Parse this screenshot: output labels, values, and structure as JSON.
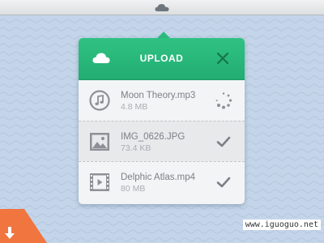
{
  "colors": {
    "background": "#c4d5e9",
    "accent_green": "#2dbd7e",
    "corner_orange": "#f0753f",
    "icon_gray": "#8d9197"
  },
  "menubar": {
    "icon": "cloud-icon"
  },
  "upload_popup": {
    "title": "UPLOAD",
    "header_icon": "cloud-icon",
    "close_icon": "close-icon",
    "files": [
      {
        "name": "Moon Theory.mp3",
        "size": "4.8 MB",
        "type_icon": "music-note-icon",
        "status": "uploading",
        "status_icon": "spinner-icon"
      },
      {
        "name": "IMG_0626.JPG",
        "size": "73.4 KB",
        "type_icon": "image-icon",
        "status": "done",
        "status_icon": "checkmark-icon"
      },
      {
        "name": "Delphic Atlas.mp4",
        "size": "80 MB",
        "type_icon": "video-film-icon",
        "status": "done",
        "status_icon": "checkmark-icon"
      }
    ]
  },
  "corner": {
    "icon": "download-arrow-icon"
  },
  "watermark": "www.iguoguo.net"
}
